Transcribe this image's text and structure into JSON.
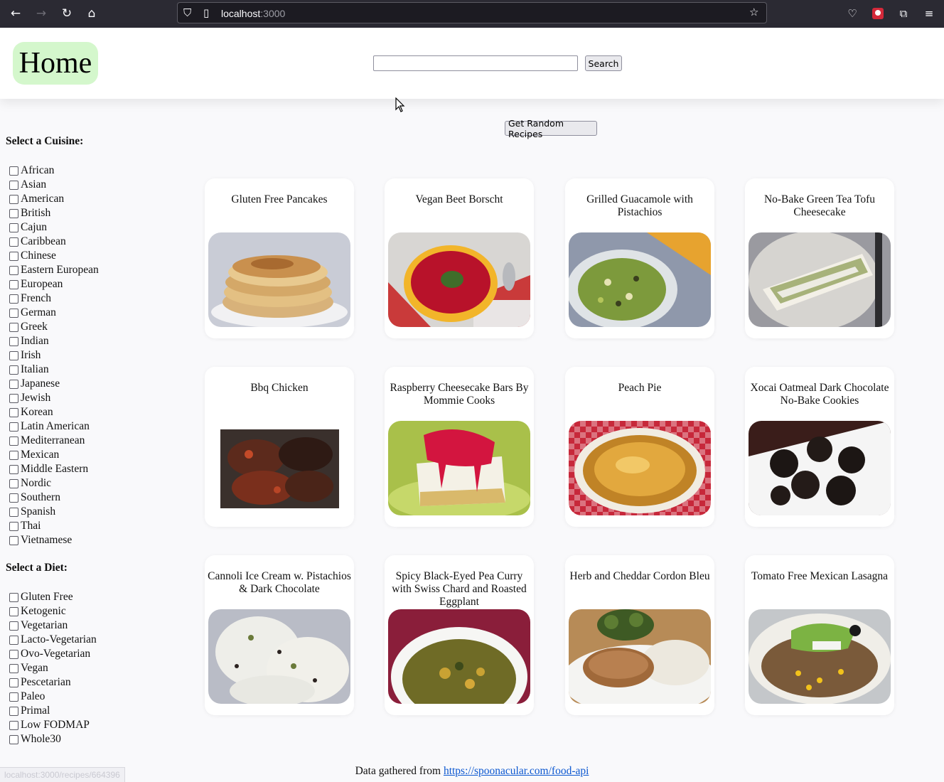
{
  "browser": {
    "url_host": "localhost",
    "url_port": ":3000"
  },
  "header": {
    "home_label": "Home",
    "search_value": "",
    "search_button": "Search"
  },
  "random_button": "Get Random Recipes",
  "cuisine": {
    "heading": "Select a Cuisine:",
    "options": [
      "African",
      "Asian",
      "American",
      "British",
      "Cajun",
      "Caribbean",
      "Chinese",
      "Eastern European",
      "European",
      "French",
      "German",
      "Greek",
      "Indian",
      "Irish",
      "Italian",
      "Japanese",
      "Jewish",
      "Korean",
      "Latin American",
      "Mediterranean",
      "Mexican",
      "Middle Eastern",
      "Nordic",
      "Southern",
      "Spanish",
      "Thai",
      "Vietnamese"
    ]
  },
  "diet": {
    "heading": "Select a Diet:",
    "options": [
      "Gluten Free",
      "Ketogenic",
      "Vegetarian",
      "Lacto-Vegetarian",
      "Ovo-Vegetarian",
      "Vegan",
      "Pescetarian",
      "Paleo",
      "Primal",
      "Low FODMAP",
      "Whole30"
    ]
  },
  "recipes": [
    {
      "title": "Gluten Free Pancakes",
      "image": "pancakes"
    },
    {
      "title": "Vegan Beet Borscht",
      "image": "borscht"
    },
    {
      "title": "Grilled Guacamole with Pistachios",
      "image": "guacamole"
    },
    {
      "title": "No-Bake Green Tea Tofu Cheesecake",
      "image": "cheesecake"
    },
    {
      "title": "Bbq Chicken",
      "image": "bbq-chicken"
    },
    {
      "title": "Raspberry Cheesecake Bars By Mommie Cooks",
      "image": "raspberry-bars"
    },
    {
      "title": "Peach Pie",
      "image": "peach-pie"
    },
    {
      "title": "Xocai Oatmeal Dark Chocolate No-Bake Cookies",
      "image": "chocolate-cookies"
    },
    {
      "title": "Cannoli Ice Cream w. Pistachios & Dark Chocolate",
      "image": "ice-cream"
    },
    {
      "title": "Spicy Black-Eyed Pea Curry with Swiss Chard and Roasted Eggplant",
      "image": "curry"
    },
    {
      "title": "Herb and Cheddar Cordon Bleu",
      "image": "cordon-bleu"
    },
    {
      "title": "Tomato Free Mexican Lasagna",
      "image": "lasagna"
    }
  ],
  "footer": {
    "prefix": "Data gathered from",
    "link": "https://spoonacular.com/food-api"
  },
  "status_bar": "localhost:3000/recipes/664396"
}
